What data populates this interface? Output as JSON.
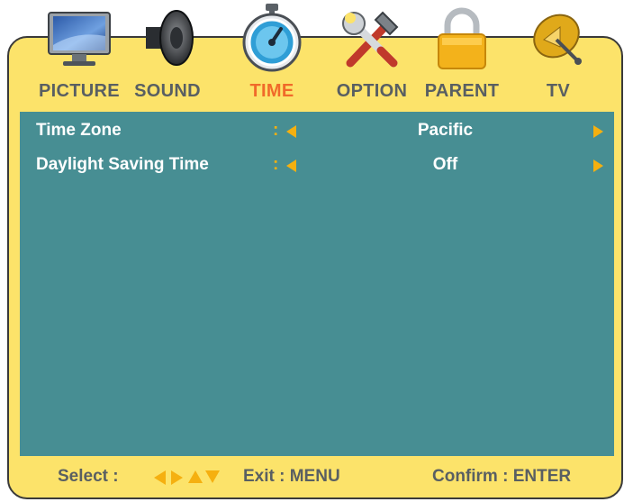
{
  "menu": {
    "tabs": [
      {
        "label": "PICTURE",
        "icon": "tv-monitor-icon",
        "active": false
      },
      {
        "label": "SOUND",
        "icon": "speaker-icon",
        "active": false
      },
      {
        "label": "TIME",
        "icon": "stopwatch-icon",
        "active": true
      },
      {
        "label": "OPTION",
        "icon": "wrench-hammer-icon",
        "active": false
      },
      {
        "label": "PARENT",
        "icon": "padlock-icon",
        "active": false
      },
      {
        "label": "TV",
        "icon": "satellite-dish-icon",
        "active": false
      }
    ]
  },
  "settings": {
    "rows": [
      {
        "name": "Time Zone",
        "separator": ":",
        "value": "Pacific"
      },
      {
        "name": "Daylight Saving Time",
        "separator": ":",
        "value": "Off"
      }
    ]
  },
  "footer": {
    "select_label": "Select :",
    "exit_label": "Exit : MENU",
    "confirm_label": "Confirm : ENTER"
  },
  "colors": {
    "frame": "#fce36a",
    "panel": "#478e93",
    "accent_arrows": "#f5b010",
    "active_tab": "#f06a2a",
    "tab_text": "#595f62"
  }
}
